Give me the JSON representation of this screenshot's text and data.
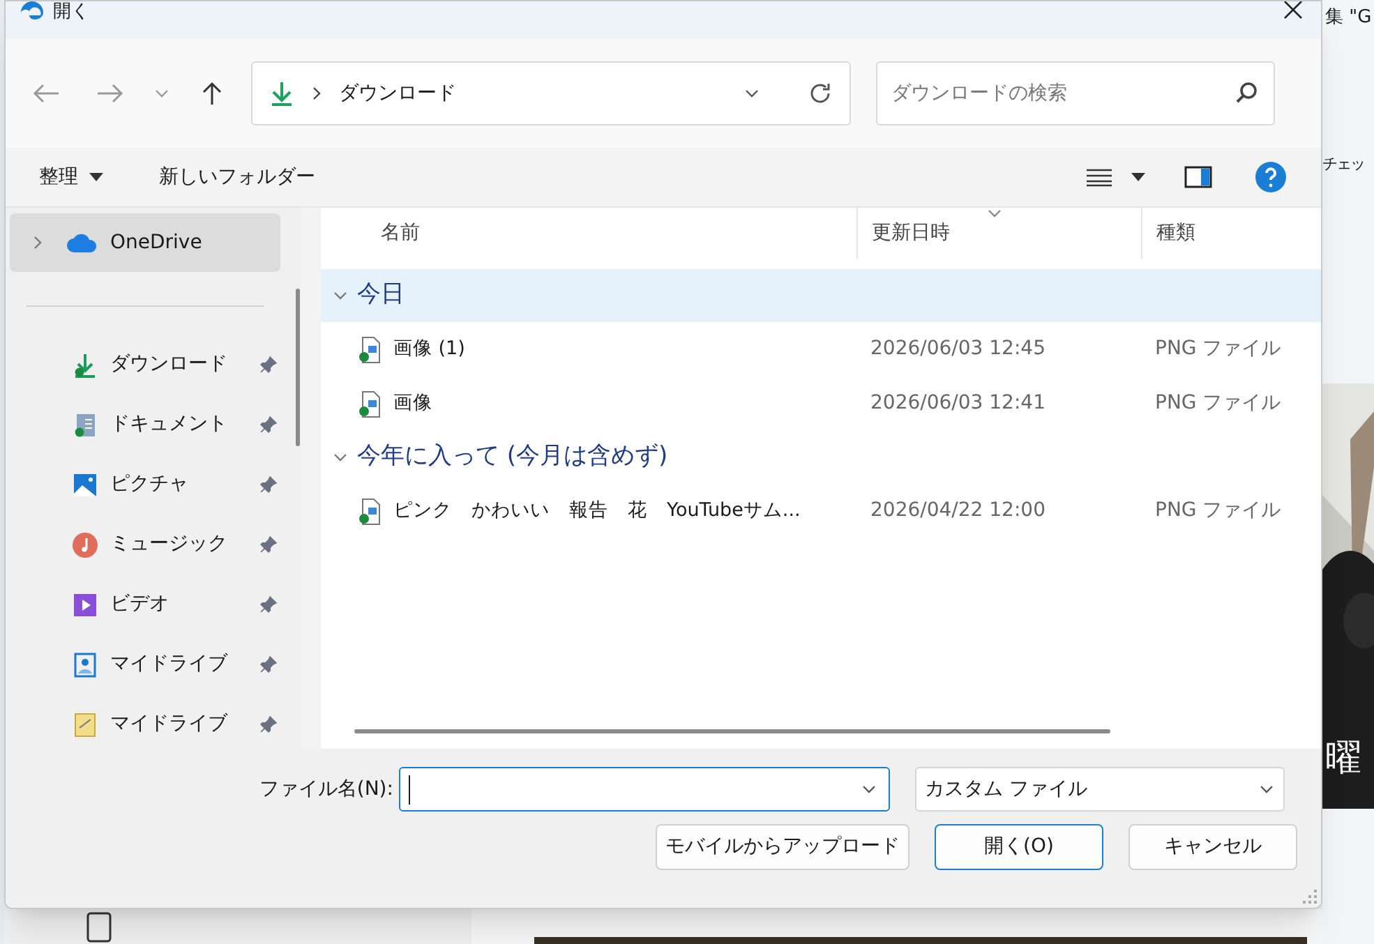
{
  "window": {
    "title": "開く"
  },
  "nav": {
    "location": "ダウンロード",
    "search": {
      "placeholder": "ダウンロードの検索"
    }
  },
  "toolbar": {
    "organize": "整理",
    "new_folder": "新しいフォルダー"
  },
  "sidebar": {
    "items": [
      {
        "label": "OneDrive",
        "kind": "cloud",
        "selected": true,
        "pinned": false
      },
      {
        "label": "ダウンロード",
        "kind": "download",
        "selected": false,
        "pinned": true
      },
      {
        "label": "ドキュメント",
        "kind": "document",
        "selected": false,
        "pinned": true
      },
      {
        "label": "ピクチャ",
        "kind": "picture",
        "selected": false,
        "pinned": true
      },
      {
        "label": "ミュージック",
        "kind": "music",
        "selected": false,
        "pinned": true
      },
      {
        "label": "ビデオ",
        "kind": "video",
        "selected": false,
        "pinned": true
      },
      {
        "label": "マイドライブ",
        "kind": "drive",
        "selected": false,
        "pinned": true
      },
      {
        "label": "マイドライブ",
        "kind": "drive2",
        "selected": false,
        "pinned": true
      }
    ]
  },
  "table": {
    "columns": [
      {
        "label": "名前",
        "sorted": false
      },
      {
        "label": "更新日時",
        "sorted": true
      },
      {
        "label": "種類",
        "sorted": false
      }
    ],
    "groups": [
      {
        "label": "今日",
        "selected": true,
        "expanded": true,
        "rows": [
          {
            "name": "画像 (1)",
            "modified": "2026/06/03 12:45",
            "type": "PNG ファイル"
          },
          {
            "name": "画像",
            "modified": "2026/06/03 12:41",
            "type": "PNG ファイル"
          }
        ]
      },
      {
        "label": "今年に入って (今月は含めず)",
        "selected": false,
        "expanded": true,
        "rows": [
          {
            "name": "ピンク　かわいい　報告　花　YouTubeサム...",
            "modified": "2026/04/22 12:00",
            "type": "PNG ファイル"
          }
        ]
      }
    ]
  },
  "footer": {
    "filename_label": "ファイル名(N):",
    "filetype": "カスタム ファイル",
    "buttons": [
      {
        "label": "モバイルからアップロード",
        "default": false
      },
      {
        "label": "開く(O)",
        "default": true
      },
      {
        "label": "キャンセル",
        "default": false
      }
    ]
  },
  "background": {
    "texts": [
      "集 \"G",
      "チェッ",
      "曜"
    ]
  }
}
